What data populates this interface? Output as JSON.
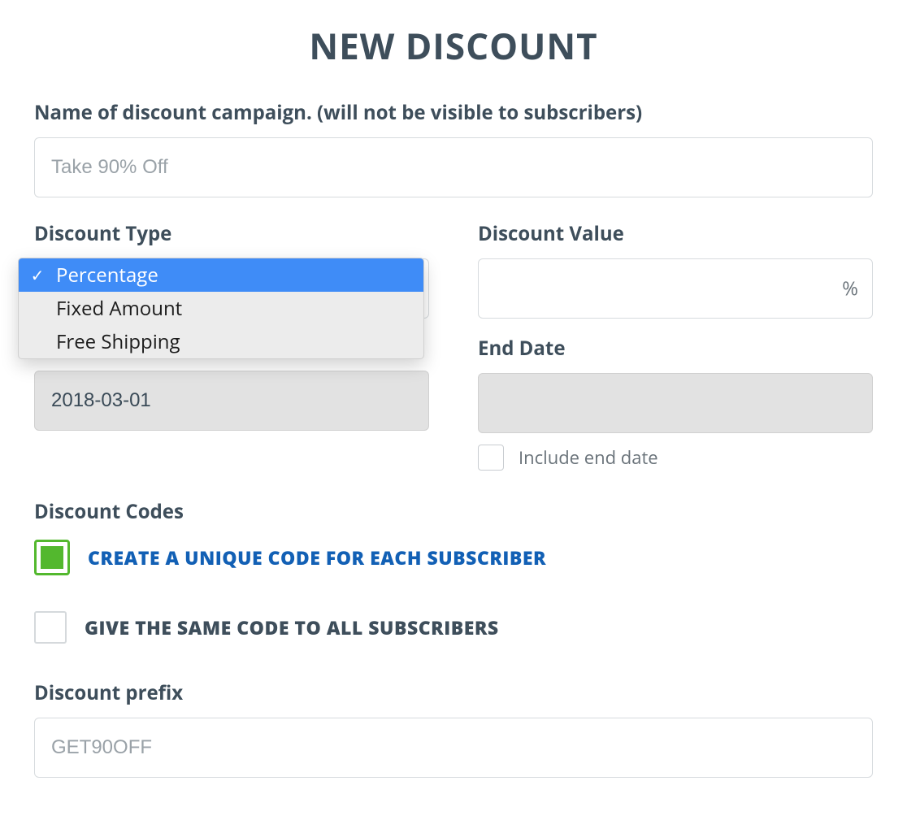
{
  "title": "NEW DISCOUNT",
  "campaign": {
    "label": "Name of discount campaign. (will not be visible to subscribers)",
    "placeholder": "Take 90% Off"
  },
  "type": {
    "label": "Discount Type",
    "options": [
      "Percentage",
      "Fixed Amount",
      "Free Shipping"
    ],
    "selected": "Percentage"
  },
  "value": {
    "label": "Discount Value",
    "suffix": "%"
  },
  "start_date": {
    "value": "2018-03-01"
  },
  "end_date": {
    "label": "End Date",
    "include_label": "Include end date"
  },
  "codes": {
    "label": "Discount Codes",
    "unique_label": "CREATE A UNIQUE CODE FOR EACH SUBSCRIBER",
    "same_label": "GIVE THE SAME CODE TO ALL SUBSCRIBERS"
  },
  "prefix": {
    "label": "Discount prefix",
    "placeholder": "GET90OFF"
  }
}
